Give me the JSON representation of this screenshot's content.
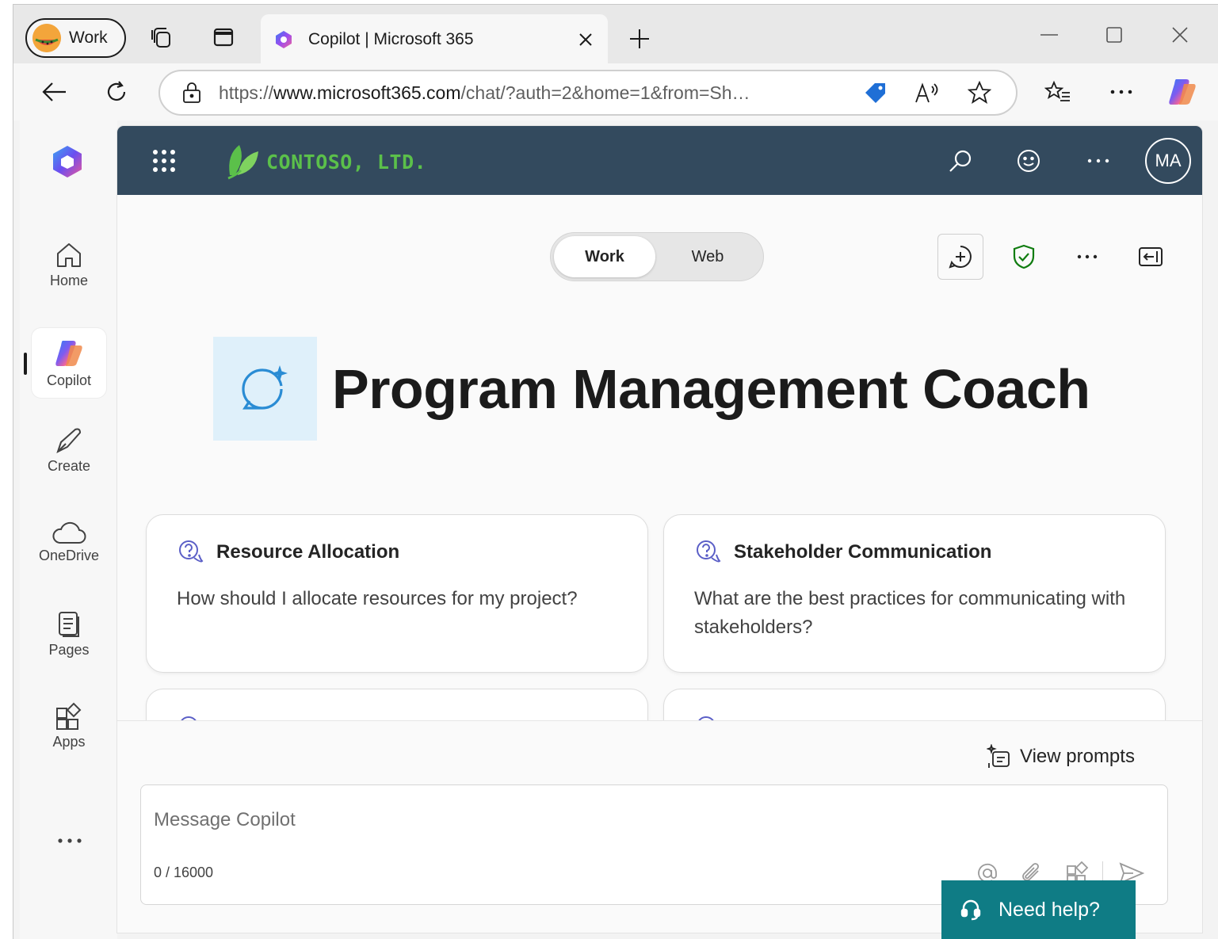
{
  "browser": {
    "profile_label": "Work",
    "tab_title": "Copilot | Microsoft 365",
    "url_prefix": "https://",
    "url_host": "www.microsoft365.com",
    "url_path": "/chat/?auth=2&home=1&from=Sh…"
  },
  "rail": {
    "items": [
      {
        "label": "Home"
      },
      {
        "label": "Copilot"
      },
      {
        "label": "Create"
      },
      {
        "label": "OneDrive"
      },
      {
        "label": "Pages"
      },
      {
        "label": "Apps"
      }
    ]
  },
  "header": {
    "brand": "CONTOSO, LTD.",
    "avatar_initials": "MA"
  },
  "mode_toggle": {
    "work": "Work",
    "web": "Web",
    "selected": "Work"
  },
  "agent": {
    "title": "Program Management Coach"
  },
  "prompts": [
    {
      "title": "Resource Allocation",
      "text": "How should I allocate resources for my project?"
    },
    {
      "title": "Stakeholder Communication",
      "text": "What are the best practices for communicating with stakeholders?"
    }
  ],
  "composer": {
    "view_prompts": "View prompts",
    "placeholder": "Message Copilot",
    "char_count": "0 / 16000"
  },
  "help": {
    "label": "Need help?"
  },
  "colors": {
    "suite_header": "#334a5e",
    "brand_green": "#5bc04a",
    "help_teal": "#0f7c85",
    "shield_green": "#107c10",
    "prompt_icon": "#5b5fc7"
  }
}
